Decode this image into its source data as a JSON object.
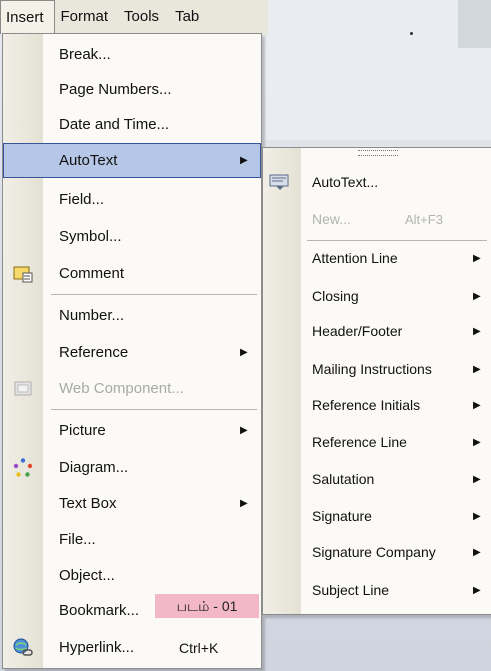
{
  "menubar": {
    "items": [
      "Insert",
      "Format",
      "Tools",
      "Tab"
    ]
  },
  "insert_menu": {
    "items": [
      {
        "label": "Break...",
        "icon": "",
        "has_submenu": false,
        "disabled": false
      },
      {
        "label": "Page Numbers...",
        "icon": "",
        "has_submenu": false,
        "disabled": false
      },
      {
        "label": "Date and Time...",
        "icon": "",
        "has_submenu": false,
        "disabled": false
      },
      {
        "label": "AutoText",
        "icon": "",
        "has_submenu": true,
        "disabled": false,
        "highlighted": true
      },
      {
        "label": "Field...",
        "icon": "",
        "has_submenu": false,
        "disabled": false
      },
      {
        "label": "Symbol...",
        "icon": "",
        "has_submenu": false,
        "disabled": false
      },
      {
        "label": "Comment",
        "icon": "comment-icon",
        "has_submenu": false,
        "disabled": false
      },
      {
        "label": "Number...",
        "icon": "",
        "has_submenu": false,
        "disabled": false
      },
      {
        "label": "Reference",
        "icon": "",
        "has_submenu": true,
        "disabled": false
      },
      {
        "label": "Web Component...",
        "icon": "web-component-icon",
        "has_submenu": false,
        "disabled": true
      },
      {
        "label": "Picture",
        "icon": "",
        "has_submenu": true,
        "disabled": false
      },
      {
        "label": "Diagram...",
        "icon": "diagram-icon",
        "has_submenu": false,
        "disabled": false
      },
      {
        "label": "Text Box",
        "icon": "",
        "has_submenu": true,
        "disabled": false
      },
      {
        "label": "File...",
        "icon": "",
        "has_submenu": false,
        "disabled": false
      },
      {
        "label": "Object...",
        "icon": "",
        "has_submenu": false,
        "disabled": false
      },
      {
        "label": "Bookmark...",
        "icon": "",
        "has_submenu": false,
        "disabled": false
      },
      {
        "label": "Hyperlink...",
        "icon": "hyperlink-icon",
        "has_submenu": false,
        "disabled": false,
        "shortcut": "Ctrl+K"
      }
    ]
  },
  "autotext_submenu": {
    "items": [
      {
        "label": "AutoText...",
        "icon": "autotext-icon",
        "has_submenu": false,
        "disabled": false
      },
      {
        "label": "New...",
        "shortcut": "Alt+F3",
        "has_submenu": false,
        "disabled": true
      },
      {
        "label": "Attention Line",
        "has_submenu": true,
        "disabled": false
      },
      {
        "label": "Closing",
        "has_submenu": true,
        "disabled": false
      },
      {
        "label": "Header/Footer",
        "has_submenu": true,
        "disabled": false
      },
      {
        "label": "Mailing Instructions",
        "has_submenu": true,
        "disabled": false
      },
      {
        "label": "Reference Initials",
        "has_submenu": true,
        "disabled": false
      },
      {
        "label": "Reference Line",
        "has_submenu": true,
        "disabled": false
      },
      {
        "label": "Salutation",
        "has_submenu": true,
        "disabled": false
      },
      {
        "label": "Signature",
        "has_submenu": true,
        "disabled": false
      },
      {
        "label": "Signature Company",
        "has_submenu": true,
        "disabled": false
      },
      {
        "label": "Subject Line",
        "has_submenu": true,
        "disabled": false
      }
    ]
  },
  "caption": {
    "text": "படம் - 01"
  },
  "colors": {
    "highlight": "#b6c6e6",
    "highlight_border": "#37549a",
    "caption_bg": "#f2b7c8"
  }
}
